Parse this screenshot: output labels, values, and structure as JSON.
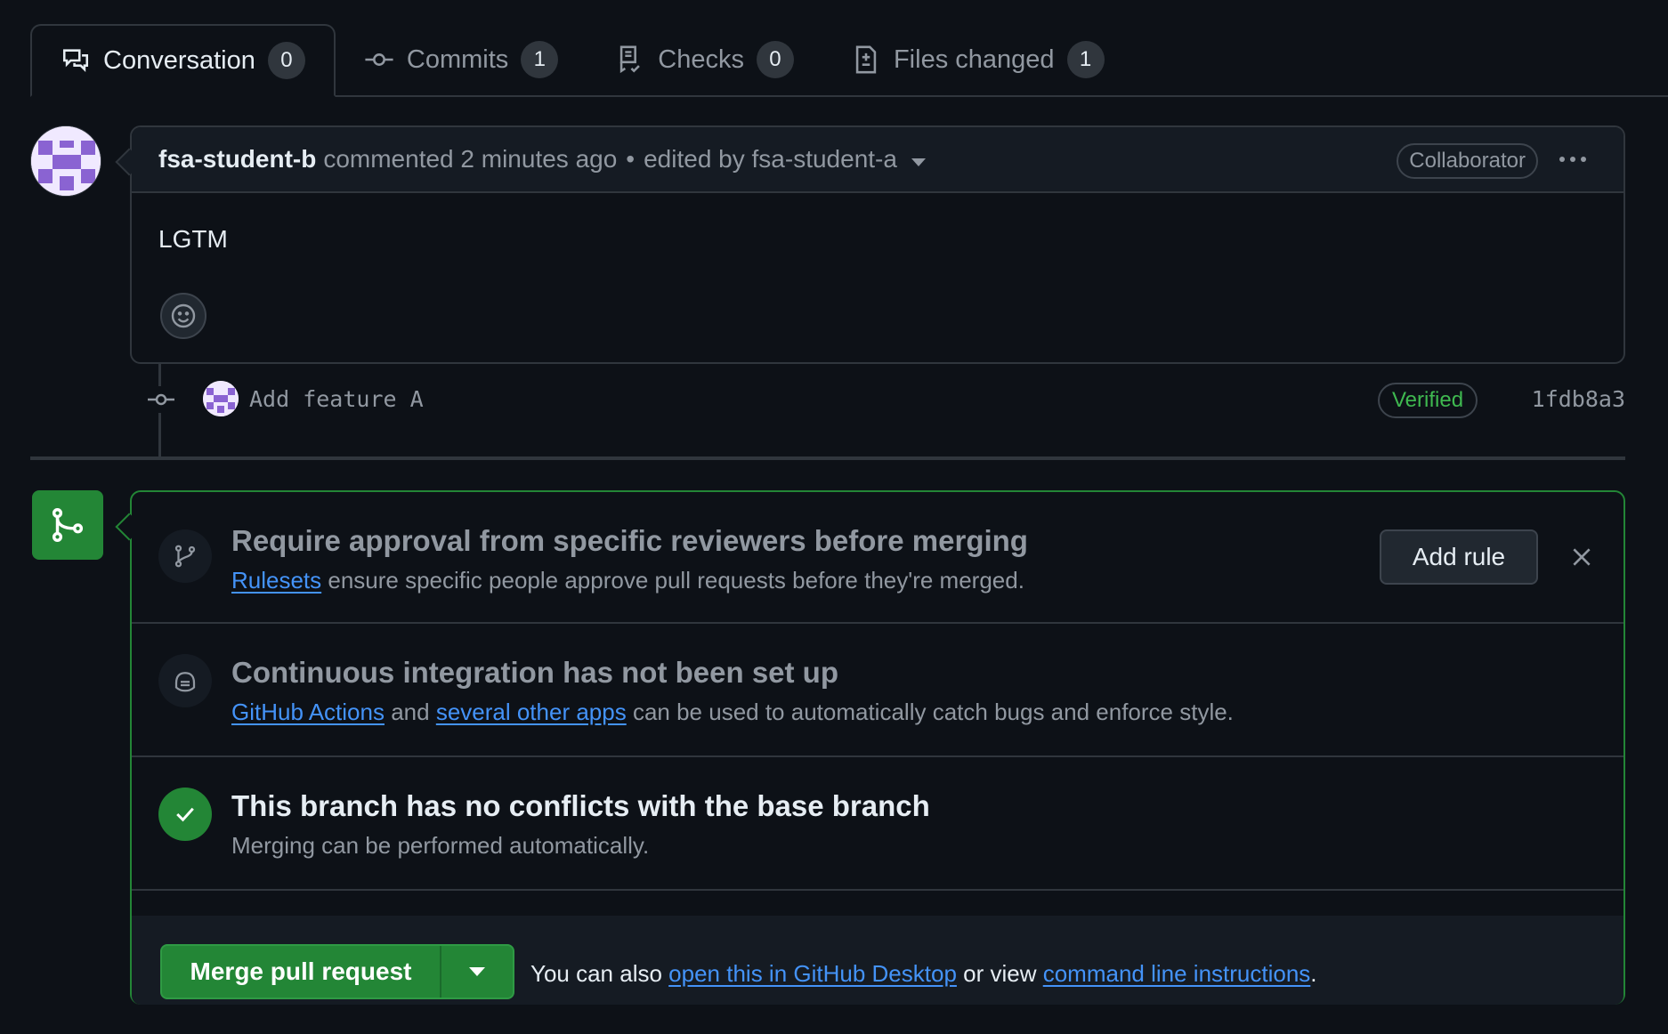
{
  "tabs": [
    {
      "label": "Conversation",
      "count": "0",
      "icon": "conversation-icon"
    },
    {
      "label": "Commits",
      "count": "1",
      "icon": "commit-icon"
    },
    {
      "label": "Checks",
      "count": "0",
      "icon": "checklist-icon"
    },
    {
      "label": "Files changed",
      "count": "1",
      "icon": "file-diff-icon"
    }
  ],
  "comment": {
    "author": "fsa-student-b",
    "action": "commented 2 minutes ago",
    "separator": "•",
    "edited": "edited by fsa-student-a",
    "role": "Collaborator",
    "body": "LGTM"
  },
  "commit": {
    "message": "Add feature A",
    "verified": "Verified",
    "sha": "1fdb8a3"
  },
  "merge": {
    "ruleset": {
      "title": "Require approval from specific reviewers before merging",
      "link": "Rulesets",
      "desc": " ensure specific people approve pull requests before they're merged.",
      "button": "Add rule"
    },
    "ci": {
      "title": "Continuous integration has not been set up",
      "link1": "GitHub Actions",
      "mid": " and ",
      "link2": "several other apps",
      "desc": " can be used to automatically catch bugs and enforce style."
    },
    "conflicts": {
      "title": "This branch has no conflicts with the base branch",
      "desc": "Merging can be performed automatically."
    },
    "footer": {
      "button": "Merge pull request",
      "prefix": "You can also ",
      "link1": "open this in GitHub Desktop",
      "mid": " or view ",
      "link2": "command line instructions",
      "suffix": "."
    }
  },
  "colors": {
    "background": "#0d1117",
    "accent_green": "#238636",
    "link_blue": "#4493f8",
    "verified_green": "#3fb950"
  }
}
